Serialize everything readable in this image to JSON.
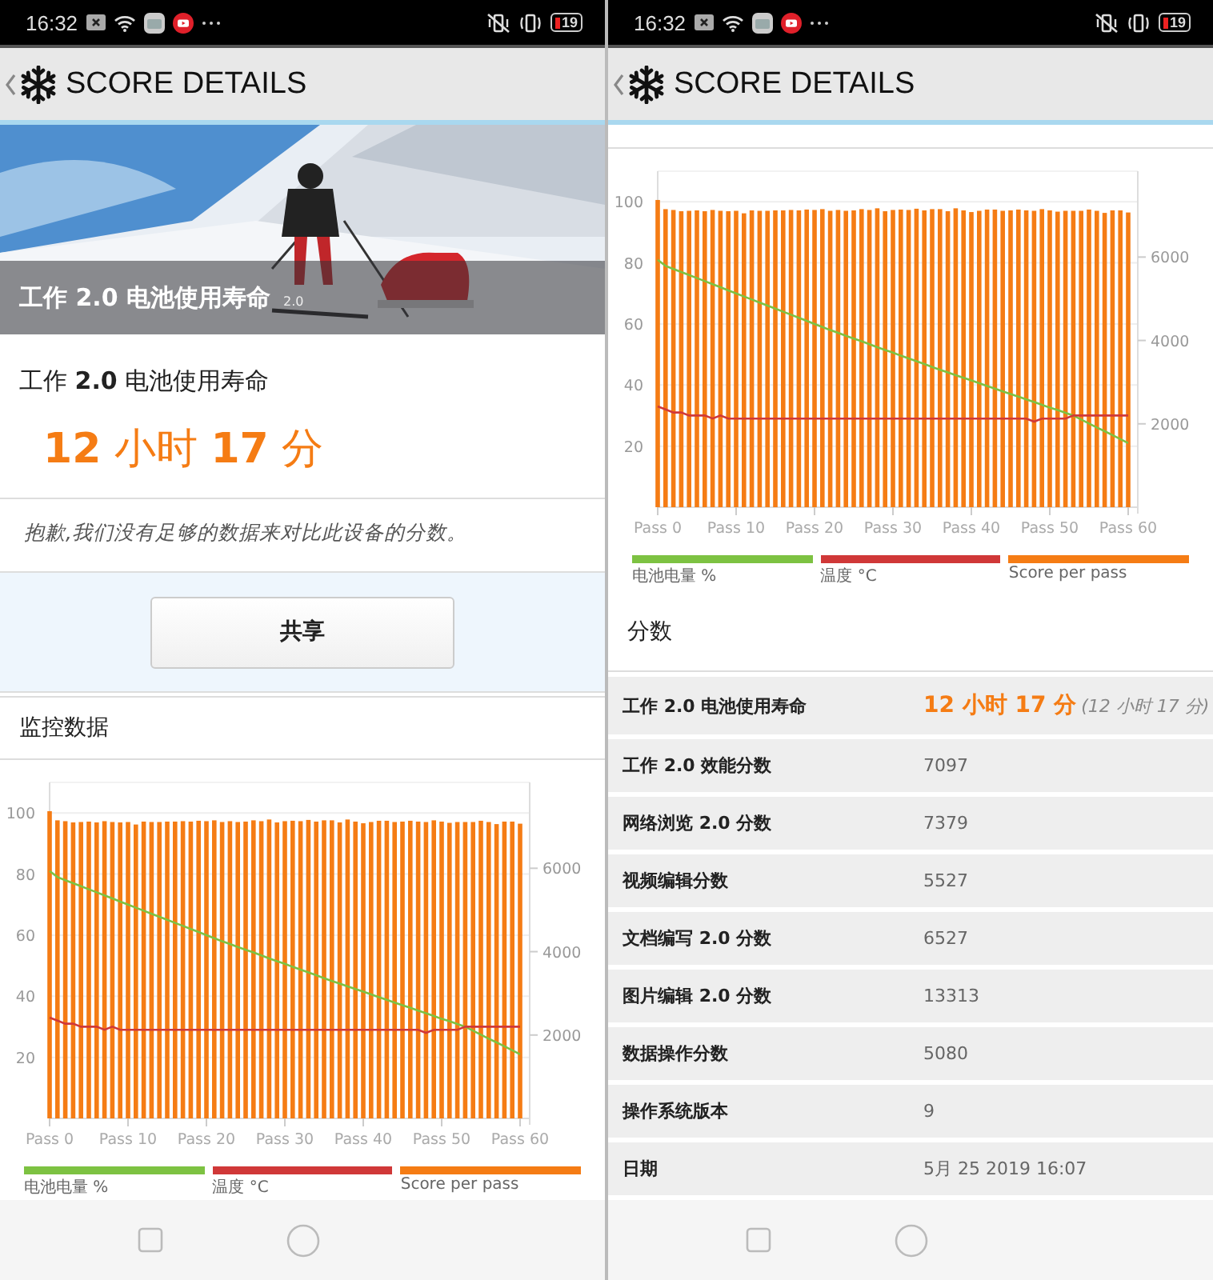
{
  "panels": [
    {
      "status_bar": {
        "time": "16:32",
        "battery": "19"
      },
      "header": {
        "title": "SCORE DETAILS"
      },
      "hero": {
        "kind": "picture",
        "title": "工作 2.0 电池使用寿命",
        "version": "2.0"
      },
      "result": {
        "title": "工作 **2.0** 电池使用寿命",
        "score": "**12** 小时 **17** 分",
        "note": "抱歉,我们没有足够的数据来对比此设备的分数。"
      },
      "share_button": "共享",
      "monitor": {
        "title": "监控数据",
        "chart_data": {
          "type": "bar",
          "categories": [
            "Pass 0",
            null,
            null,
            null,
            null,
            null,
            null,
            null,
            null,
            null,
            "Pass 10",
            null,
            null,
            null,
            null,
            null,
            null,
            null,
            null,
            null,
            "Pass 20",
            null,
            null,
            null,
            null,
            null,
            null,
            null,
            null,
            null,
            "Pass 30",
            null,
            null,
            null,
            null,
            null,
            null,
            null,
            null,
            null,
            "Pass 40",
            null,
            null,
            null,
            null,
            null,
            null,
            null,
            null,
            null,
            "Pass 50",
            null,
            null,
            null,
            null,
            null,
            null,
            null,
            null,
            null,
            "Pass 60"
          ],
          "ylim": [
            0,
            110
          ],
          "y2lim": [
            0,
            8060
          ],
          "yticks": [
            20,
            40,
            60,
            80,
            100
          ],
          "y2ticks": [
            2000,
            4000,
            6000
          ],
          "grid": true,
          "series": [
            {
              "name": "电池电量 %",
              "type": "line",
              "color": "#7dc242",
              "values": [
                81,
                79,
                78,
                77,
                76,
                75,
                74,
                73,
                72,
                71,
                70,
                69,
                68,
                67,
                66,
                65,
                64,
                63,
                62,
                61,
                60,
                59,
                58,
                57.1,
                56.1,
                55.2,
                54.3,
                53.4,
                52.4,
                51.5,
                50.6,
                49.6,
                48.7,
                47.8,
                46.9,
                45.9,
                45,
                44.1,
                43.2,
                42.4,
                41.5,
                40.6,
                39.7,
                38.8,
                37.9,
                37.1,
                36.2,
                35.3,
                34.4,
                33.5,
                32.6,
                31.8,
                30.9,
                30,
                28.7,
                27.4,
                26.1,
                24.9,
                23.6,
                22.3,
                21
              ]
            },
            {
              "name": "温度 °C",
              "type": "line",
              "color": "#d03838",
              "values": [
                33,
                32,
                31,
                31,
                30,
                30,
                30,
                29,
                30,
                29,
                29,
                29,
                29,
                29,
                29,
                29,
                29,
                29,
                29,
                29,
                29,
                29,
                29,
                29,
                29,
                29,
                29,
                29,
                29,
                29,
                29,
                29,
                29,
                29,
                29,
                29,
                29,
                29,
                29,
                29,
                29,
                29,
                29,
                29,
                29,
                29,
                29,
                29,
                28,
                29,
                29,
                29,
                29,
                30,
                30,
                30,
                30,
                30,
                30,
                30,
                30
              ]
            },
            {
              "name": "Score per pass",
              "axis": "y2",
              "color": "#f57c14",
              "values": [
                7370,
                7150,
                7130,
                7100,
                7110,
                7120,
                7100,
                7130,
                7110,
                7100,
                7110,
                7050,
                7120,
                7110,
                7110,
                7120,
                7120,
                7130,
                7120,
                7140,
                7130,
                7150,
                7110,
                7130,
                7110,
                7120,
                7150,
                7130,
                7170,
                7100,
                7130,
                7140,
                7130,
                7160,
                7120,
                7150,
                7150,
                7100,
                7170,
                7120,
                7080,
                7110,
                7140,
                7140,
                7110,
                7120,
                7140,
                7120,
                7110,
                7150,
                7120,
                7090,
                7110,
                7110,
                7110,
                7140,
                7110,
                7060,
                7120,
                7120,
                7070
              ]
            }
          ]
        }
      }
    },
    {
      "status_bar": {
        "time": "16:32",
        "battery": "19"
      },
      "header": {
        "title": "SCORE DETAILS"
      },
      "monitor": {
        "chart_data": {
          "type": "bar",
          "categories": [
            "Pass 0",
            null,
            null,
            null,
            null,
            null,
            null,
            null,
            null,
            null,
            "Pass 10",
            null,
            null,
            null,
            null,
            null,
            null,
            null,
            null,
            null,
            "Pass 20",
            null,
            null,
            null,
            null,
            null,
            null,
            null,
            null,
            null,
            "Pass 30",
            null,
            null,
            null,
            null,
            null,
            null,
            null,
            null,
            null,
            "Pass 40",
            null,
            null,
            null,
            null,
            null,
            null,
            null,
            null,
            null,
            "Pass 50",
            null,
            null,
            null,
            null,
            null,
            null,
            null,
            null,
            null,
            "Pass 60"
          ],
          "ylim": [
            0,
            110
          ],
          "y2lim": [
            0,
            8060
          ],
          "yticks": [
            20,
            40,
            60,
            80,
            100
          ],
          "y2ticks": [
            2000,
            4000,
            6000
          ],
          "grid": true,
          "series": [
            {
              "name": "电池电量 %",
              "type": "line",
              "color": "#7dc242",
              "values": [
                81,
                79,
                78,
                77,
                76,
                75,
                74,
                73,
                72,
                71,
                70,
                69,
                68,
                67,
                66,
                65,
                64,
                63,
                62,
                61,
                60,
                59,
                58,
                57.1,
                56.1,
                55.2,
                54.3,
                53.4,
                52.4,
                51.5,
                50.6,
                49.6,
                48.7,
                47.8,
                46.9,
                45.9,
                45,
                44.1,
                43.2,
                42.4,
                41.5,
                40.6,
                39.7,
                38.8,
                37.9,
                37.1,
                36.2,
                35.3,
                34.4,
                33.5,
                32.6,
                31.8,
                30.9,
                30,
                28.7,
                27.4,
                26.1,
                24.9,
                23.6,
                22.3,
                21
              ]
            },
            {
              "name": "温度 °C",
              "type": "line",
              "color": "#d03838",
              "values": [
                33,
                32,
                31,
                31,
                30,
                30,
                30,
                29,
                30,
                29,
                29,
                29,
                29,
                29,
                29,
                29,
                29,
                29,
                29,
                29,
                29,
                29,
                29,
                29,
                29,
                29,
                29,
                29,
                29,
                29,
                29,
                29,
                29,
                29,
                29,
                29,
                29,
                29,
                29,
                29,
                29,
                29,
                29,
                29,
                29,
                29,
                29,
                29,
                28,
                29,
                29,
                29,
                29,
                30,
                30,
                30,
                30,
                30,
                30,
                30,
                30
              ]
            },
            {
              "name": "Score per pass",
              "axis": "y2",
              "color": "#f57c14",
              "values": [
                7370,
                7150,
                7130,
                7100,
                7110,
                7120,
                7100,
                7130,
                7110,
                7100,
                7110,
                7050,
                7120,
                7110,
                7110,
                7120,
                7120,
                7130,
                7120,
                7140,
                7130,
                7150,
                7110,
                7130,
                7110,
                7120,
                7150,
                7130,
                7170,
                7100,
                7130,
                7140,
                7130,
                7160,
                7120,
                7150,
                7150,
                7100,
                7170,
                7120,
                7080,
                7110,
                7140,
                7140,
                7110,
                7120,
                7140,
                7120,
                7110,
                7150,
                7120,
                7090,
                7110,
                7110,
                7110,
                7140,
                7110,
                7060,
                7120,
                7120,
                7070
              ]
            }
          ]
        }
      },
      "scores": {
        "title": "分数",
        "rows": [
          {
            "label": "工作 2.0 电池使用寿命",
            "value": "12 小时 17 分",
            "note": "(12 小时 17 分)",
            "highlight": true
          },
          {
            "label": "工作 2.0 效能分数",
            "value": "7097",
            "highlight": false
          },
          {
            "label": "网络浏览 2.0 分数",
            "value": "7379",
            "highlight": false
          },
          {
            "label": "视频编辑分数",
            "value": "5527",
            "highlight": false
          },
          {
            "label": "文档编写 2.0 分数",
            "value": "6527",
            "highlight": false
          },
          {
            "label": "图片编辑 2.0 分数",
            "value": "13313",
            "highlight": false
          },
          {
            "label": "数据操作分数",
            "value": "5080",
            "highlight": false
          },
          {
            "label": "操作系统版本",
            "value": "9",
            "highlight": false
          },
          {
            "label": "日期",
            "value": "5月 25 2019 16:07",
            "highlight": false
          }
        ]
      }
    }
  ]
}
